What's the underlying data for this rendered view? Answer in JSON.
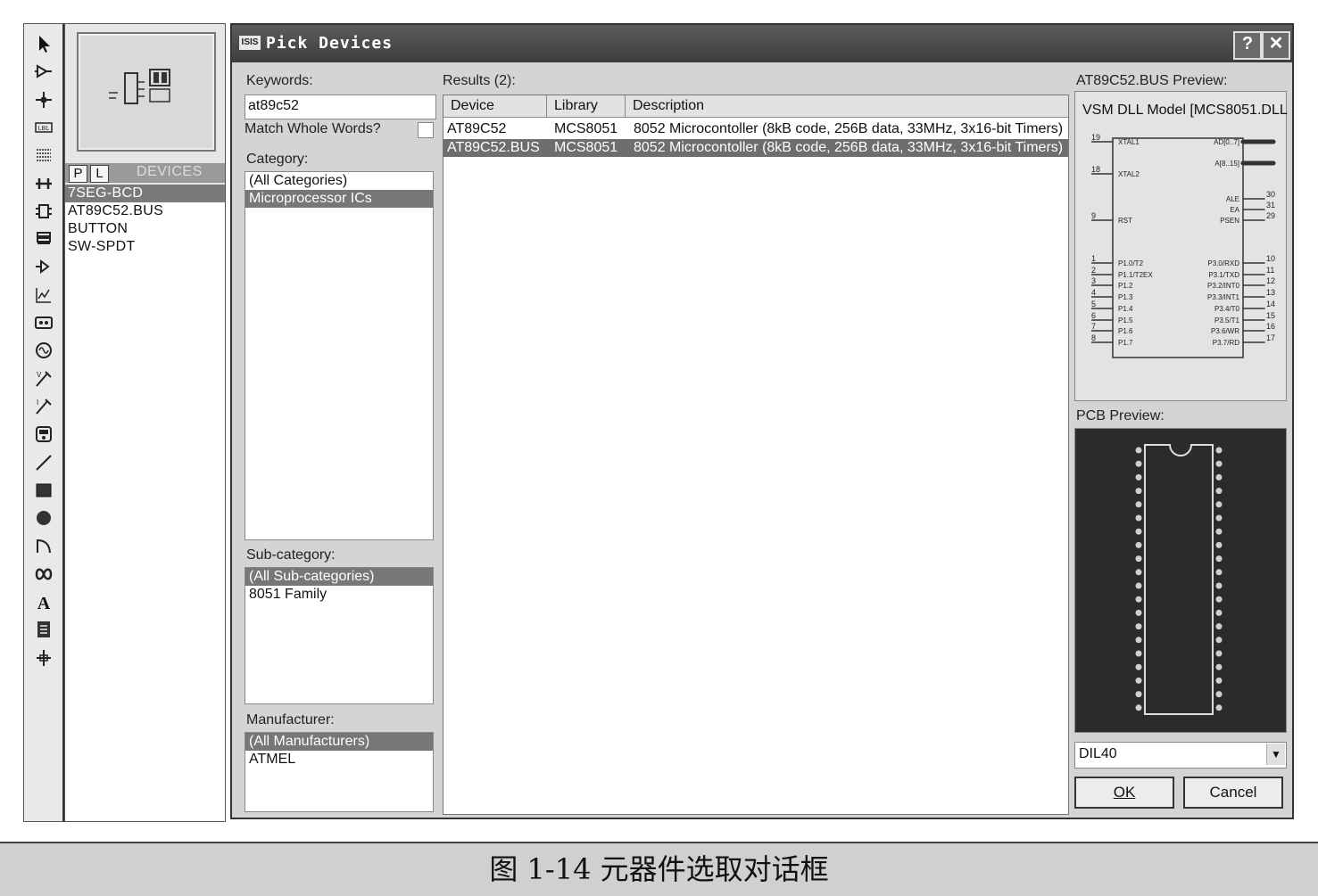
{
  "dialog": {
    "title": "Pick Devices",
    "title_logo": "ISIS",
    "help_button": "?",
    "close_button": "✕",
    "keywords_label": "Keywords:",
    "keywords_value": "at89c52",
    "match_whole_words_label": "Match Whole Words?",
    "category_label": "Category:",
    "categories": [
      "(All Categories)",
      "Microprocessor ICs"
    ],
    "selected_category": 1,
    "subcategory_label": "Sub-category:",
    "subcategories": [
      "(All Sub-categories)",
      "8051 Family"
    ],
    "manufacturer_label": "Manufacturer:",
    "manufacturers": [
      "(All Manufacturers)",
      "ATMEL"
    ],
    "results_label": "Results (2):",
    "results_columns": [
      "Device",
      "Library",
      "Description"
    ],
    "results_rows": [
      {
        "device": "AT89C52",
        "library": "MCS8051",
        "description": "8052 Microcontoller (8kB code, 256B data, 33MHz, 3x16-bit Timers)"
      },
      {
        "device": "AT89C52.BUS",
        "library": "MCS8051",
        "description": "8052 Microcontoller (8kB code, 256B data, 33MHz, 3x16-bit Timers)"
      }
    ],
    "selected_result": 1,
    "preview_label": "AT89C52.BUS Preview:",
    "preview_model_text": "VSM DLL Model [MCS8051.DLL",
    "pcb_label": "PCB Preview:",
    "package_value": "DIL40",
    "ok_button": "OK",
    "cancel_button": "Cancel"
  },
  "device_panel": {
    "tab_p": "P",
    "tab_l": "L",
    "title": "DEVICES",
    "items": [
      "7SEG-BCD",
      "AT89C52.BUS",
      "BUTTON",
      "SW-SPDT"
    ],
    "selected": 0
  },
  "toolbar_icons": [
    "select-arrow-icon",
    "component-icon",
    "junction-dot-icon",
    "wire-label-icon",
    "text-script-icon",
    "bus-icon",
    "subcircuit-icon",
    "terminal-icon",
    "device-pin-icon",
    "graph-icon",
    "tape-recorder-icon",
    "generator-icon",
    "voltage-probe-icon",
    "current-probe-icon",
    "virtual-instrument-icon",
    "line-icon",
    "box-icon",
    "circle-icon",
    "arc-icon",
    "path-icon",
    "text-icon",
    "symbol-icon",
    "marker-icon"
  ],
  "schematic": {
    "left_pins": [
      {
        "num": "19",
        "name": "XTAL1"
      },
      {
        "num": "18",
        "name": "XTAL2"
      },
      {
        "num": "9",
        "name": "RST"
      },
      {
        "num": "1",
        "name": "P1.0/T2"
      },
      {
        "num": "2",
        "name": "P1.1/T2EX"
      },
      {
        "num": "3",
        "name": "P1.2"
      },
      {
        "num": "4",
        "name": "P1.3"
      },
      {
        "num": "5",
        "name": "P1.4"
      },
      {
        "num": "6",
        "name": "P1.5"
      },
      {
        "num": "7",
        "name": "P1.6"
      },
      {
        "num": "8",
        "name": "P1.7"
      }
    ],
    "right_pins": [
      {
        "num": "",
        "name": "AD[0..7]"
      },
      {
        "num": "",
        "name": "A[8..15]"
      },
      {
        "num": "30",
        "name": "ALE"
      },
      {
        "num": "31",
        "name": "EA"
      },
      {
        "num": "29",
        "name": "PSEN"
      },
      {
        "num": "10",
        "name": "P3.0/RXD"
      },
      {
        "num": "11",
        "name": "P3.1/TXD"
      },
      {
        "num": "12",
        "name": "P3.2/INT0"
      },
      {
        "num": "13",
        "name": "P3.3/INT1"
      },
      {
        "num": "14",
        "name": "P3.4/T0"
      },
      {
        "num": "15",
        "name": "P3.5/T1"
      },
      {
        "num": "16",
        "name": "P3.6/WR"
      },
      {
        "num": "17",
        "name": "P3.7/RD"
      }
    ]
  },
  "caption": "图 1-14    元器件选取对话框"
}
